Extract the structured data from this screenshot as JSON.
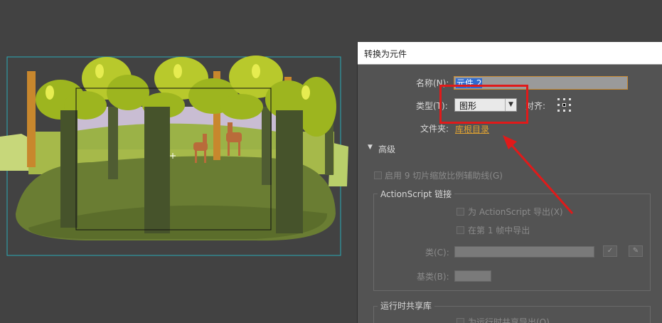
{
  "dialog": {
    "title": "转换为元件",
    "name_label": "名称(N):",
    "name_value": "元件 2",
    "type_label": "类型(T):",
    "type_value": "图形",
    "align_label": "对齐:",
    "folder_label": "文件夹:",
    "folder_link": "库根目录",
    "advanced_label": "高级",
    "enable_9slice": "启用 9 切片缩放比例辅助线(G)",
    "actionscript_group": "ActionScript 链接",
    "export_as": "为 ActionScript 导出(X)",
    "export_frame1": "在第 1 帧中导出",
    "class_label": "类(C):",
    "base_class_label": "基类(B):",
    "runtime_group": "运行时共享库",
    "runtime_export": "为运行时共享导出(O)"
  },
  "annotation": {
    "color": "#e01a1a"
  },
  "colors": {
    "workspace": "#424242",
    "stage_border": "#2aa9b5",
    "dialog_bg": "#535353",
    "name_border": "#c88a32",
    "link": "#e2a332"
  }
}
